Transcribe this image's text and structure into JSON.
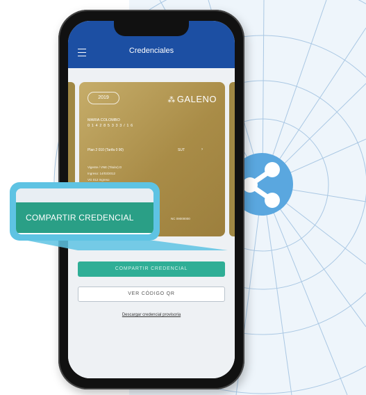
{
  "app": {
    "title": "Credenciales"
  },
  "card": {
    "year": "2019",
    "brand": "GALENO",
    "name": "MARIA COLOMBO",
    "number": "0 1 4 2 8 5 3 3 3 / 1 6",
    "plan": "Plan 2 010 (Tarifa 0 90)",
    "plan_code": "SUT",
    "lines": [
      "Vigente / VNE (Titular) D",
      "Ingreso: 14/03/2012",
      "VG 012 Ingreso"
    ],
    "footer": "NC 09000000"
  },
  "callout": {
    "label": "COMPARTIR CREDENCIAL"
  },
  "buttons": {
    "share": "COMPARTIR CREDENCIAL",
    "qr": "VER CÓDIGO QR",
    "provisional_link": "Descargar credencial provisoria"
  },
  "icons": {
    "share": "share-icon",
    "menu": "hamburger-menu-icon",
    "logo": "galeno-logo-icon"
  },
  "colors": {
    "appbar": "#1c4fa3",
    "card_gold": "#a98c47",
    "share_button": "#2fae96",
    "callout_border": "#5ec3e3",
    "share_circle": "#5aa7df"
  }
}
